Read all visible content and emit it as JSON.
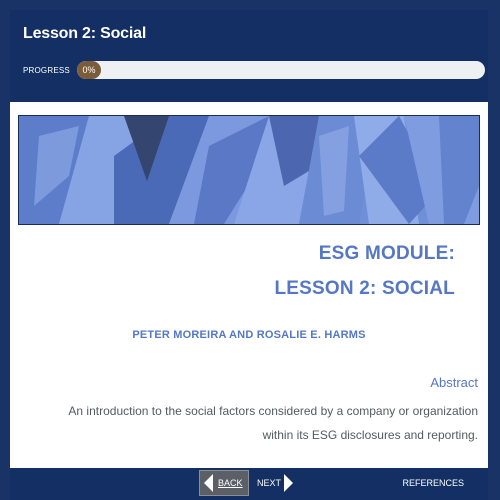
{
  "header": {
    "title": "Lesson 2: Social",
    "progress_label": "PROGRESS",
    "progress_value": 0,
    "progress_text": "0%"
  },
  "banner": {
    "image": "abstract-blue-architecture-banner"
  },
  "title_block": {
    "line1": "ESG MODULE:",
    "line2": "LESSON 2: SOCIAL",
    "authors": "PETER MOREIRA AND ROSALIE E. HARMS"
  },
  "abstract": {
    "heading": "Abstract",
    "text": "An introduction to the social factors considered by a company or organization within its ESG disclosures and reporting."
  },
  "footer": {
    "back_label": "BACK",
    "next_label": "NEXT",
    "references_label": "REFERENCES"
  },
  "colors": {
    "navy": "#142f63",
    "accent": "#5577c4",
    "progress_fill": "#7a5c3a",
    "body_text": "#555a60"
  }
}
